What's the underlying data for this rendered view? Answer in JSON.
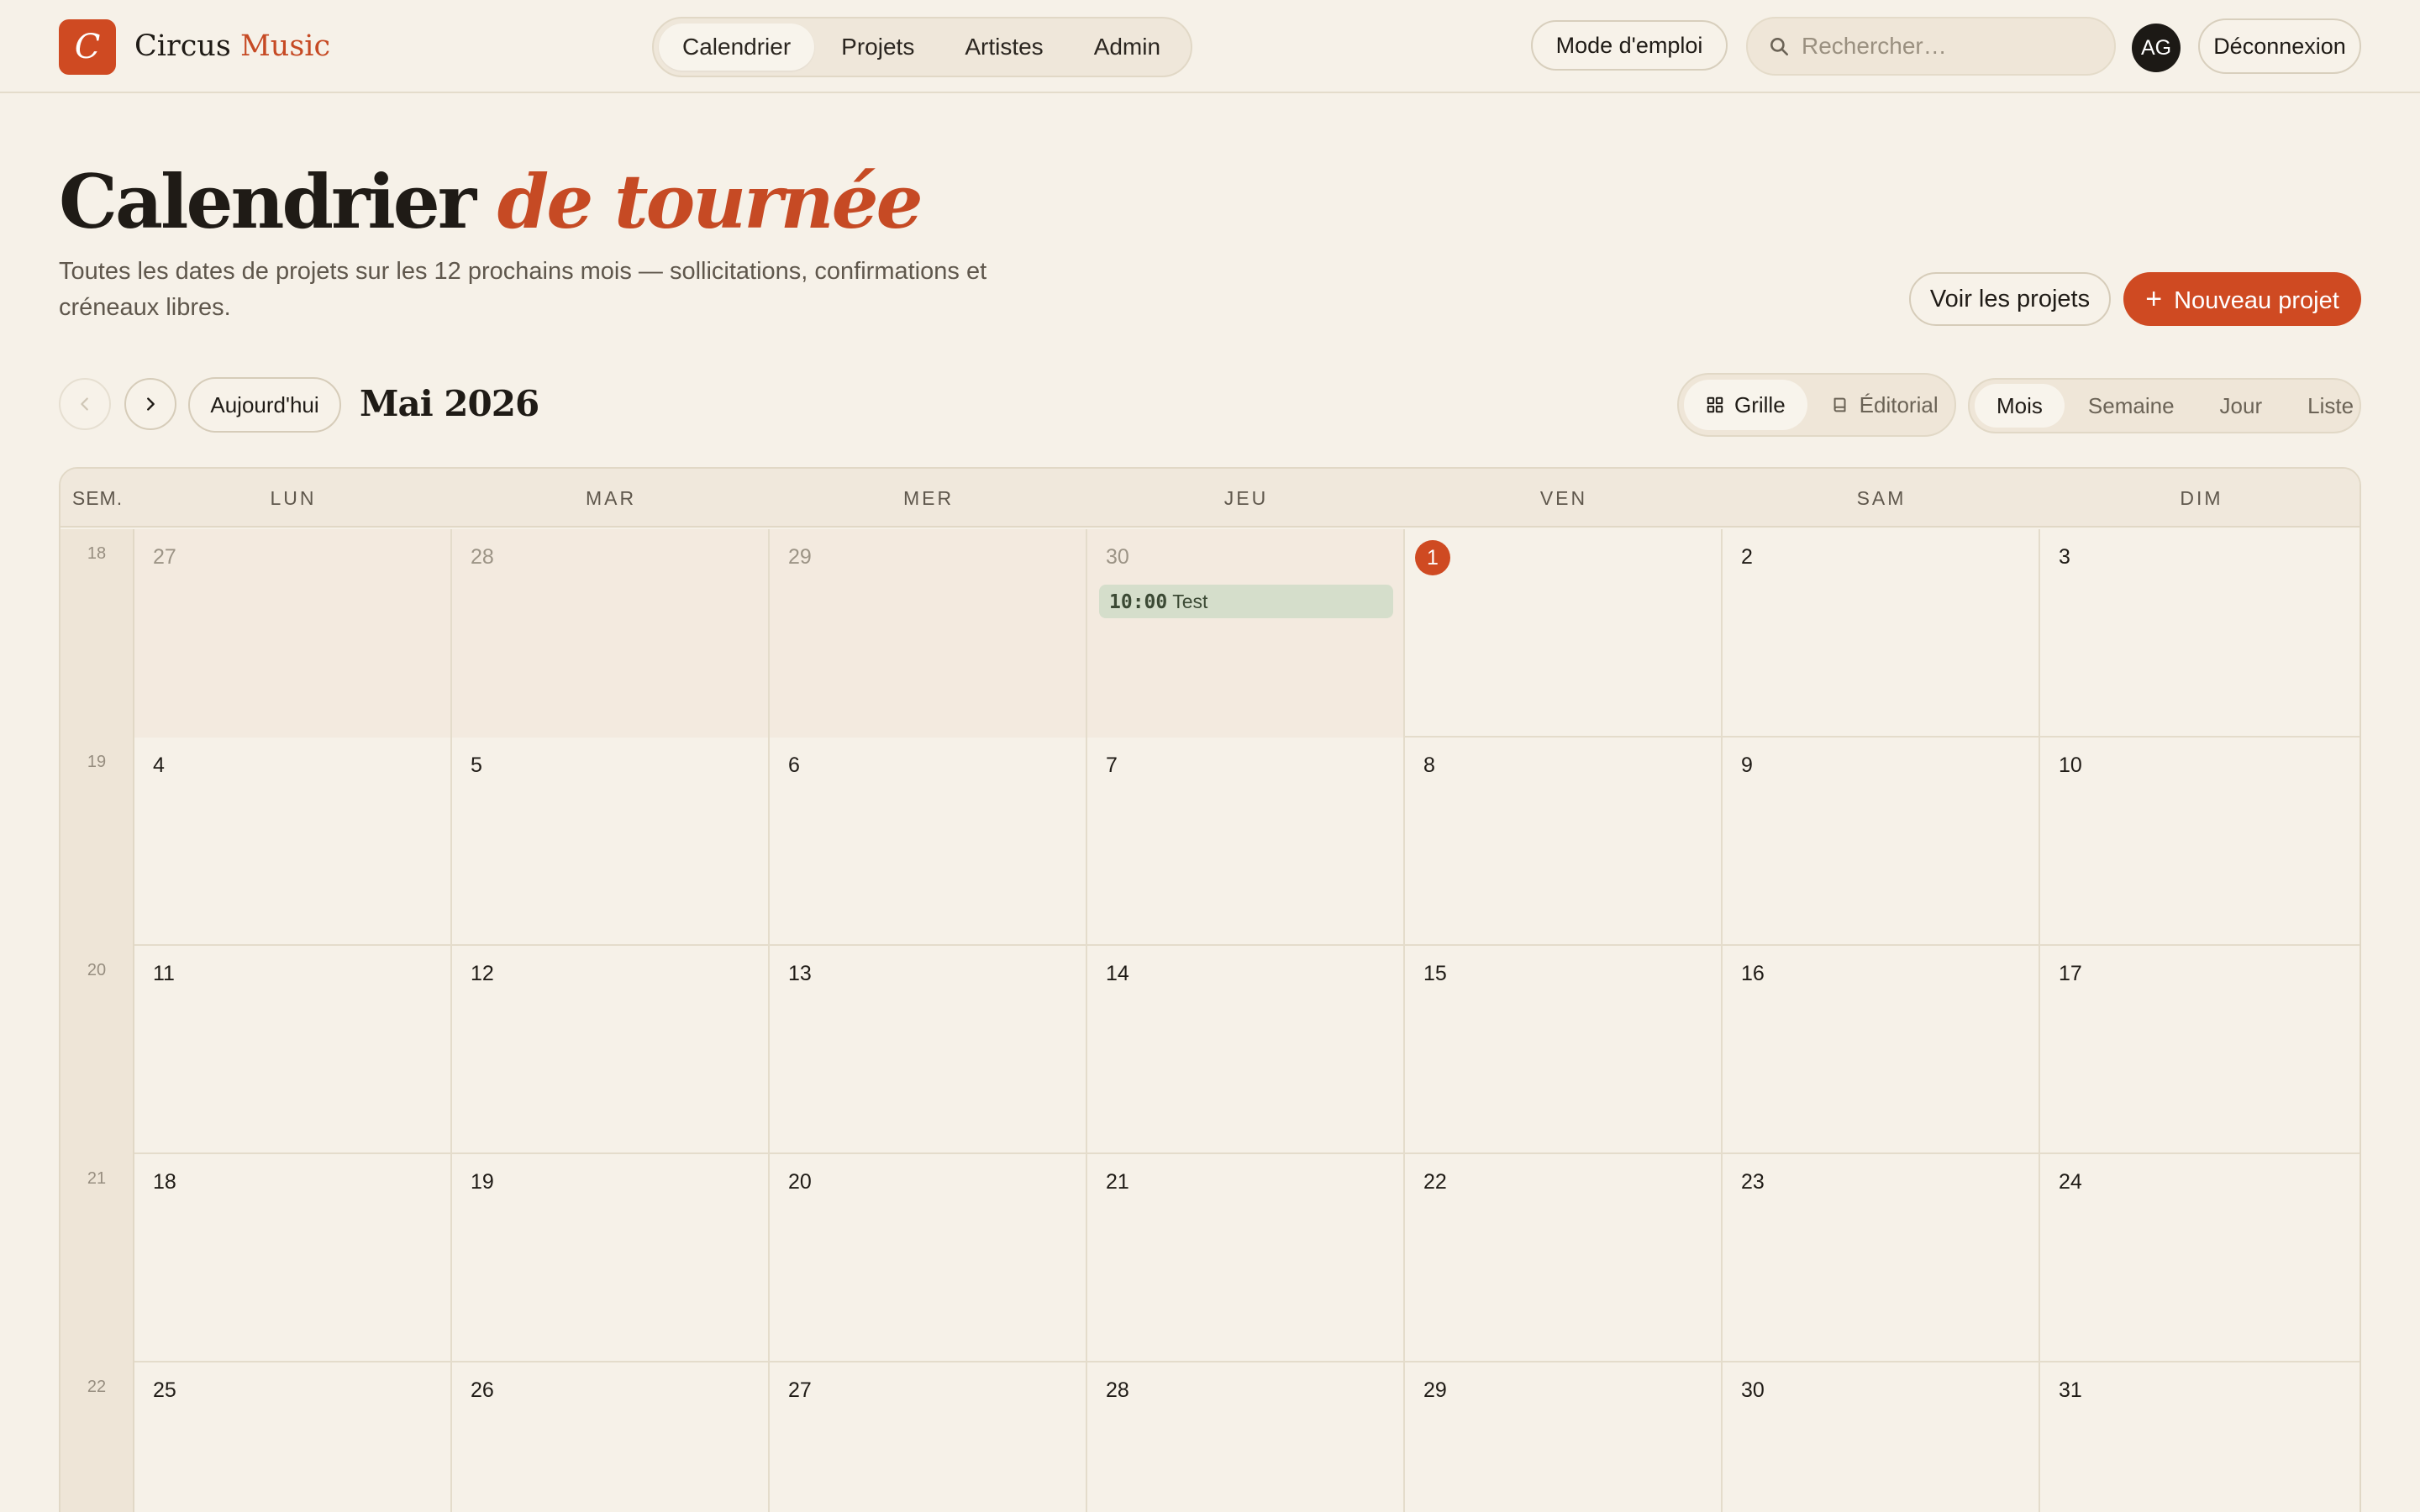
{
  "brand": {
    "logo_letter": "C",
    "name_part1": "Circus",
    "name_part2": "Music",
    "accent_color": "#cf4a22"
  },
  "nav": {
    "items": [
      "Calendrier",
      "Projets",
      "Artistes",
      "Admin"
    ],
    "active": "Calendrier"
  },
  "top_actions": {
    "help_label": "Mode d'emploi",
    "search_placeholder": "Rechercher…",
    "avatar_initials": "AG",
    "logout_label": "Déconnexion"
  },
  "header": {
    "title_main": "Calendrier",
    "title_accent": "de tournée",
    "subtitle": "Toutes les dates de projets sur les 12 prochains mois — sollicitations, confirmations et créneaux libres.",
    "view_projects_label": "Voir les projets",
    "new_project_label": "Nouveau projet"
  },
  "toolbar": {
    "today_label": "Aujourd'hui",
    "month_title": "Mai 2026",
    "layout_toggle": {
      "items": [
        "Grille",
        "Éditorial"
      ],
      "active": "Grille"
    },
    "view_toggle": {
      "items": [
        "Mois",
        "Semaine",
        "Jour",
        "Liste"
      ],
      "active": "Mois"
    }
  },
  "calendar": {
    "week_header": "SEM.",
    "day_headers": [
      "LUN",
      "MAR",
      "MER",
      "JEU",
      "VEN",
      "SAM",
      "DIM"
    ],
    "weeks": [
      {
        "number": "18",
        "days": [
          {
            "num": "27",
            "outside": true
          },
          {
            "num": "28",
            "outside": true
          },
          {
            "num": "29",
            "outside": true
          },
          {
            "num": "30",
            "outside": true,
            "event": {
              "time": "10:00",
              "title": "Test",
              "color": "#d5decb"
            }
          },
          {
            "num": "1",
            "today": true
          },
          {
            "num": "2"
          },
          {
            "num": "3"
          }
        ]
      },
      {
        "number": "19",
        "days": [
          {
            "num": "4"
          },
          {
            "num": "5"
          },
          {
            "num": "6"
          },
          {
            "num": "7"
          },
          {
            "num": "8"
          },
          {
            "num": "9"
          },
          {
            "num": "10"
          }
        ]
      },
      {
        "number": "20",
        "days": [
          {
            "num": "11"
          },
          {
            "num": "12"
          },
          {
            "num": "13"
          },
          {
            "num": "14"
          },
          {
            "num": "15"
          },
          {
            "num": "16"
          },
          {
            "num": "17"
          }
        ]
      },
      {
        "number": "21",
        "days": [
          {
            "num": "18"
          },
          {
            "num": "19"
          },
          {
            "num": "20"
          },
          {
            "num": "21"
          },
          {
            "num": "22"
          },
          {
            "num": "23"
          },
          {
            "num": "24"
          }
        ]
      },
      {
        "number": "22",
        "days": [
          {
            "num": "25"
          },
          {
            "num": "26"
          },
          {
            "num": "27"
          },
          {
            "num": "28"
          },
          {
            "num": "29"
          },
          {
            "num": "30"
          },
          {
            "num": "31"
          }
        ]
      }
    ]
  },
  "icons": [
    "search-icon",
    "chevron-left-icon",
    "chevron-right-icon",
    "grid-icon",
    "book-icon",
    "plus-icon"
  ]
}
